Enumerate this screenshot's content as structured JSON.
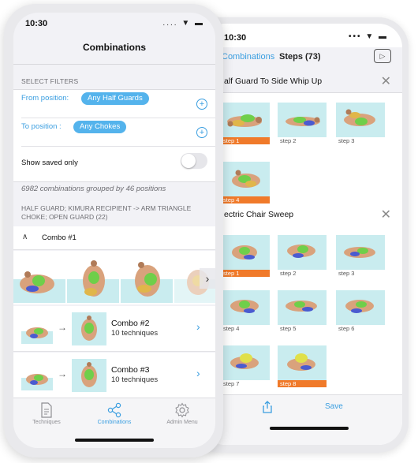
{
  "back_screen": {
    "status": {
      "time": "10:30",
      "icons": "••• ▼ ▬"
    },
    "nav": {
      "tab_combinations": "Combinations",
      "tab_steps": "Steps (73)",
      "play_icon": "play-square-icon"
    },
    "sections": [
      {
        "title": "alf Guard To Side Whip Up",
        "steps": [
          {
            "label": "step 1",
            "active": true
          },
          {
            "label": "step 2",
            "active": false
          },
          {
            "label": "step 3",
            "active": false
          },
          {
            "label": "step 4",
            "active": true
          }
        ]
      },
      {
        "title": "ectric Chair Sweep",
        "steps": [
          {
            "label": "step 1",
            "active": true
          },
          {
            "label": "step 2",
            "active": false
          },
          {
            "label": "step 3",
            "active": false
          },
          {
            "label": "step 4",
            "active": false
          },
          {
            "label": "step 5",
            "active": false
          },
          {
            "label": "step 6",
            "active": false
          },
          {
            "label": "step 7",
            "active": false
          },
          {
            "label": "step 8",
            "active": true
          }
        ]
      }
    ],
    "close_icon": "✕",
    "toolbar": {
      "share_icon": "share-icon",
      "save_label": "Save"
    }
  },
  "front_screen": {
    "status": {
      "time": "10:30",
      "icons": ".... ▼ ▬"
    },
    "title": "Combinations",
    "filters": {
      "heading": "SELECT FILTERS",
      "from_label": "From position:",
      "from_value": "Any Half Guards",
      "to_label": "To position :",
      "to_value": "Any Chokes",
      "saved_label": "Show saved only",
      "saved_on": false
    },
    "summary": "6982 combinations grouped by 46 positions",
    "group_header": "HALF GUARD; KIMURA RECIPIENT -> ARM TRIANGLE CHOKE; OPEN GUARD (22)",
    "combo1": {
      "caret": "∧",
      "title": "Combo #1",
      "chevron": "›"
    },
    "combos": [
      {
        "title": "Combo #2",
        "subtitle": "10 techniques",
        "arrow": "→",
        "chevron": "›"
      },
      {
        "title": "Combo #3",
        "subtitle": "10 techniques",
        "arrow": "→",
        "chevron": "›"
      }
    ],
    "tabbar": [
      {
        "label": "Techniques",
        "icon": "document-icon",
        "active": false
      },
      {
        "label": "Combinations",
        "icon": "share-nodes-icon",
        "active": true
      },
      {
        "label": "Admin Menu",
        "icon": "gear-icon",
        "active": false
      }
    ]
  },
  "colors": {
    "accent": "#3a9ee0",
    "chip": "#54b3ec",
    "active_step": "#f07a2a",
    "mat": "#c9ecef",
    "background": "#f2f2f6"
  }
}
